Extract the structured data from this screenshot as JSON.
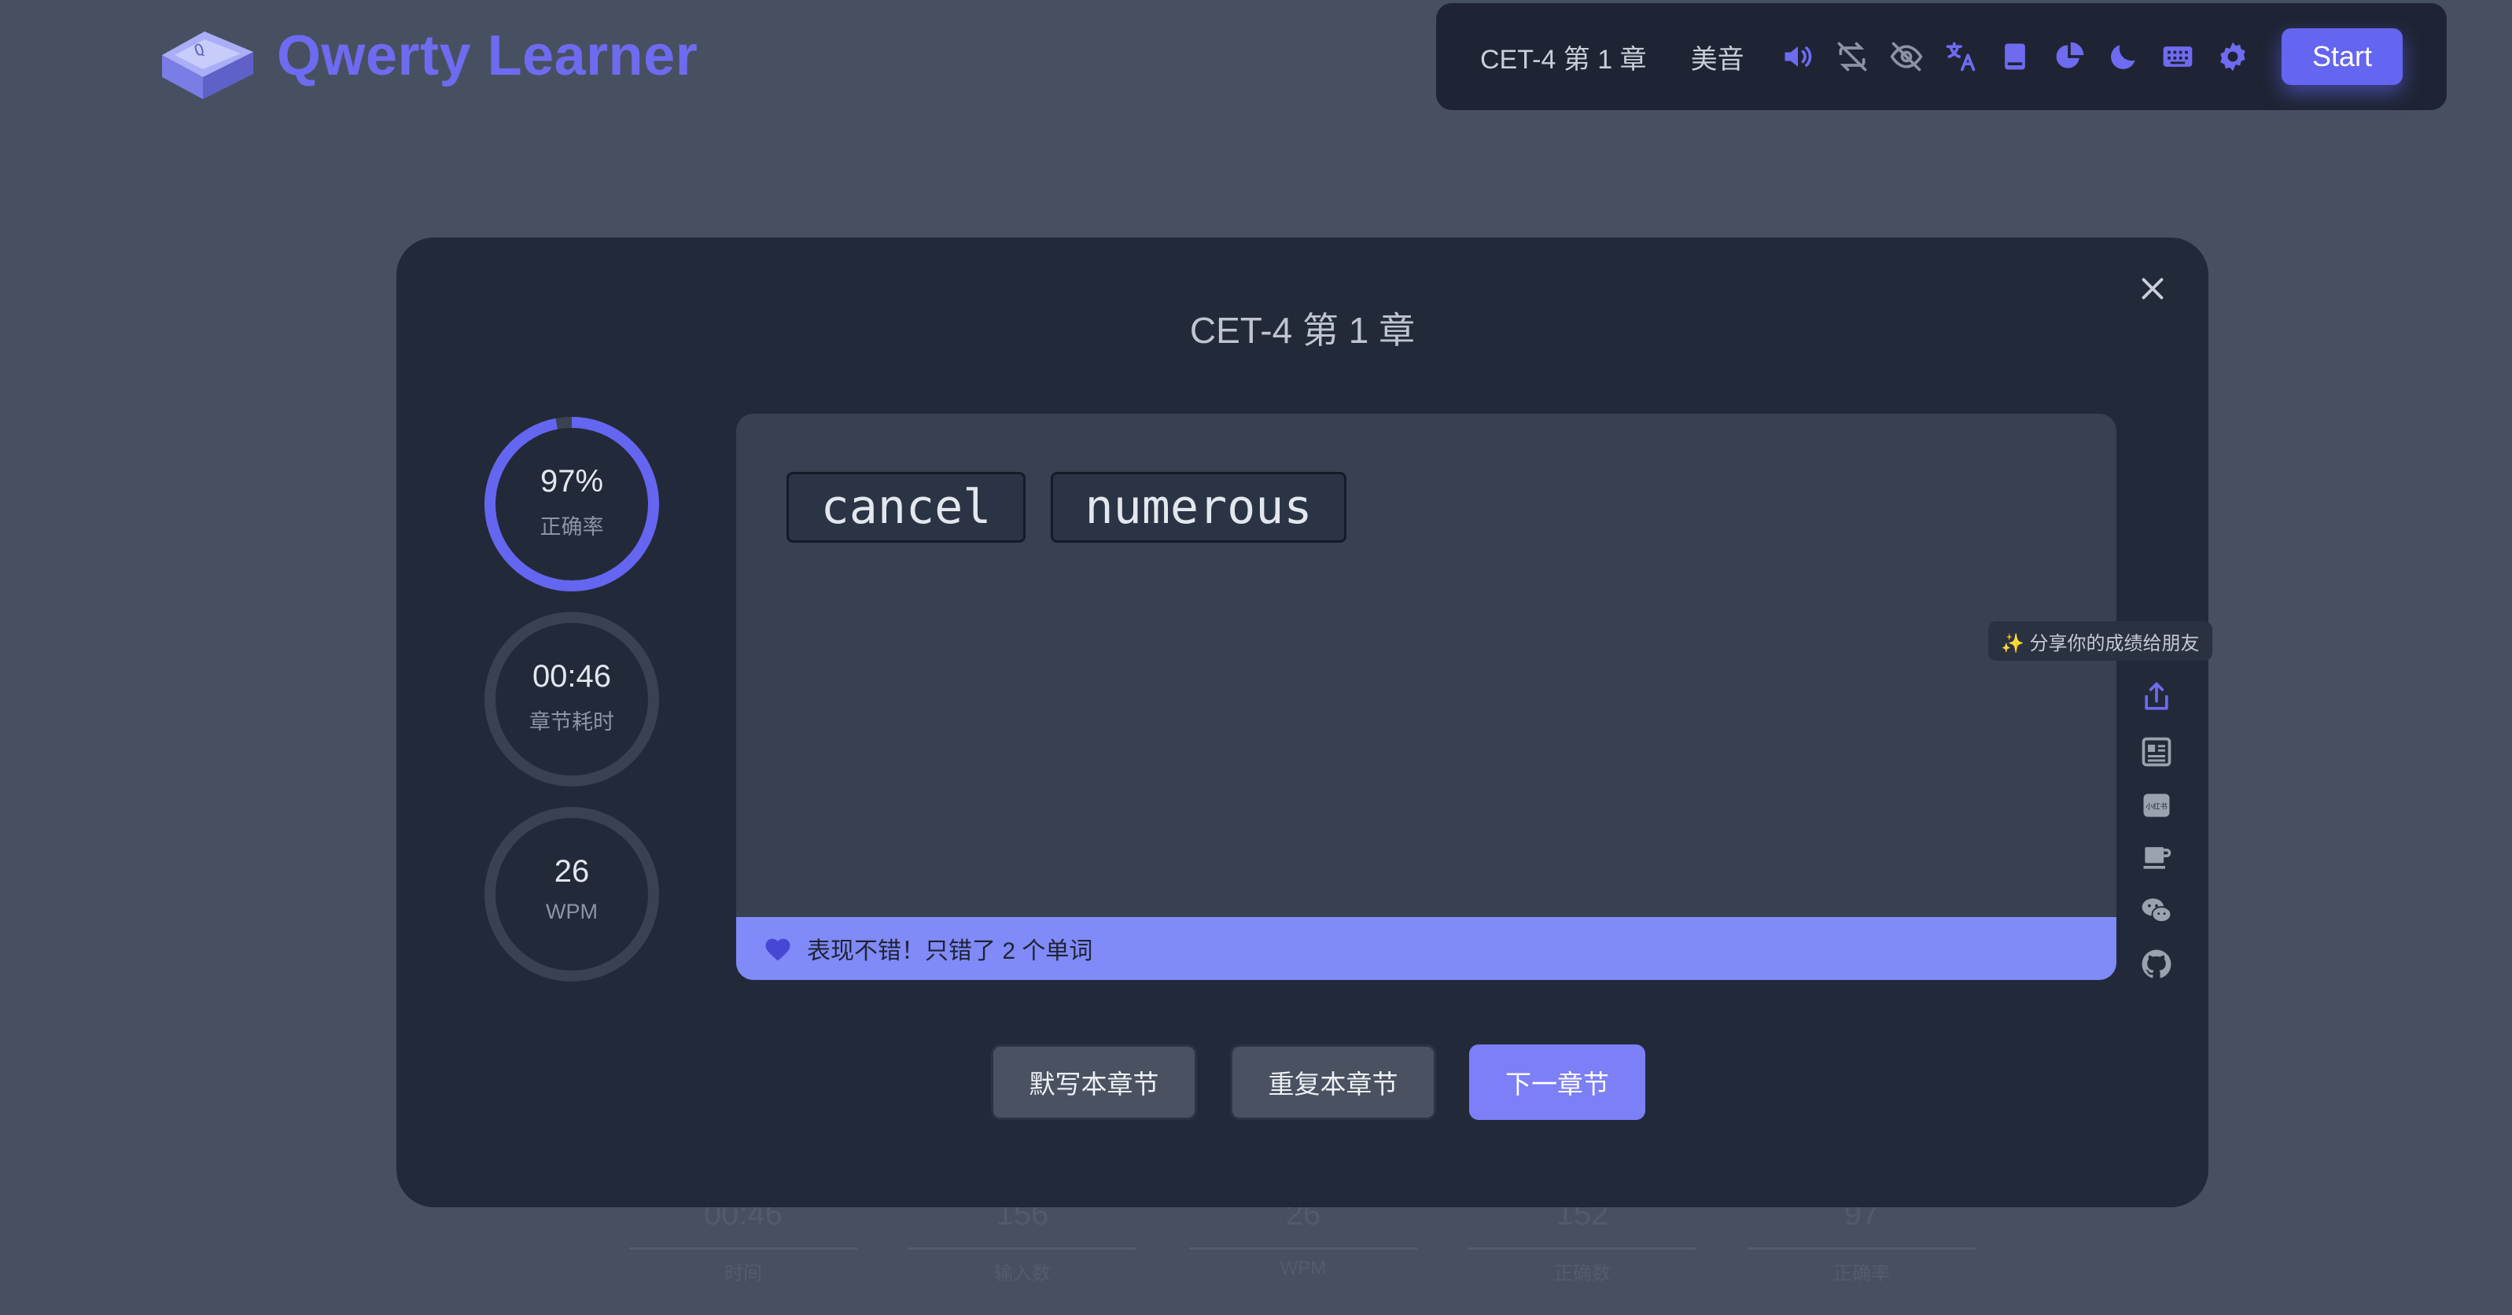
{
  "brand": {
    "name": "Qwerty Learner"
  },
  "toolbar": {
    "dict_chapter": "CET-4 第 1 章",
    "accent": "美音",
    "icons": [
      "volume-icon",
      "loop-off-icon",
      "eye-off-icon",
      "translate-icon",
      "book-icon",
      "pie-chart-icon",
      "moon-icon",
      "keyboard-icon",
      "gear-icon"
    ],
    "start_label": "Start",
    "accent_color": "#6466f1"
  },
  "modal": {
    "title": "CET-4 第 1 章",
    "stats": [
      {
        "value": "97%",
        "label": "正确率",
        "progress": 0.97
      },
      {
        "value": "00:46",
        "label": "章节耗时"
      },
      {
        "value": "26",
        "label": "WPM"
      }
    ],
    "wrong_words": [
      "cancel",
      "numerous"
    ],
    "message": "表现不错！只错了 2 个单词",
    "share_tip": "✨ 分享你的成绩给朋友",
    "side_icons": [
      "share-icon",
      "article-icon",
      "xiaohongshu-icon",
      "coffee-icon",
      "wechat-icon",
      "github-icon"
    ],
    "buttons": {
      "dictation": "默写本章节",
      "repeat": "重复本章节",
      "next": "下一章节"
    }
  },
  "background_stats": [
    {
      "value": "00:46",
      "label": "时间"
    },
    {
      "value": "156",
      "label": "输入数"
    },
    {
      "value": "26",
      "label": "WPM"
    },
    {
      "value": "152",
      "label": "正确数"
    },
    {
      "value": "97",
      "label": "正确率"
    }
  ]
}
